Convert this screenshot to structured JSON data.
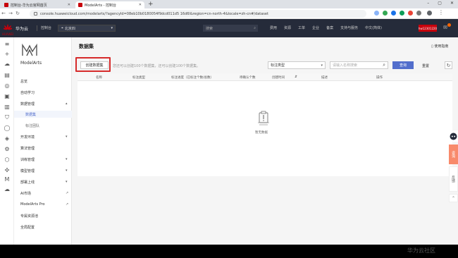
{
  "browser": {
    "tabs": [
      {
        "label": "控制台-华为云官网首页"
      },
      {
        "label": "ModelArts - 控制台"
      }
    ],
    "new_tab": "+",
    "window_controls": [
      "–",
      "▢",
      "✕"
    ],
    "url": "console.huaweicloud.com/modelarts/?agencyId=08eb10b0180054f9dcd011d5 16d6l&region=cn-north-4&locale=zh-cn#/dataset"
  },
  "header": {
    "brand_name": "华为云",
    "brand_sub": "HUAWEI",
    "console_label": "控制台",
    "region": "北京四",
    "search_placeholder": "搜索",
    "links": [
      "费用",
      "资源",
      "工单",
      "企业",
      "备案",
      "支持与服务",
      "中文(简体)"
    ],
    "account": "hw12301220"
  },
  "sidebar": {
    "logo_text": "ModelArts",
    "items": [
      {
        "label": "总览"
      },
      {
        "label": "自动学习"
      },
      {
        "label": "数据管理"
      },
      {
        "label": "数据集"
      },
      {
        "label": "标注团队"
      },
      {
        "label": "开发环境"
      },
      {
        "label": "算法管理"
      },
      {
        "label": "训练管理"
      },
      {
        "label": "模型管理"
      },
      {
        "label": "部署上线"
      },
      {
        "label": "AI市场"
      },
      {
        "label": "ModelArts Pro"
      },
      {
        "label": "专属资源池"
      },
      {
        "label": "全局配置"
      }
    ]
  },
  "main": {
    "title": "数据集",
    "user_guide": "使用指南",
    "create_button": "创建数据集",
    "limit_text": "您还可以创建100个数据集，还可以创建100个数据集。",
    "type_select": "标注类型",
    "search_placeholder": "请输入名称搜索",
    "query_button": "查询",
    "reset_link": "重置",
    "columns": [
      "名称",
      "标注类型",
      "标注进度（已标注个数/总数）",
      "待确认个数",
      "创建时间",
      "描述",
      "操作"
    ],
    "sort_icon": "⇵",
    "empty_text": "暂无数据"
  },
  "floating": {
    "support_label": "咨询",
    "feedback_label": "反馈"
  },
  "watermark": "华为云社区"
}
